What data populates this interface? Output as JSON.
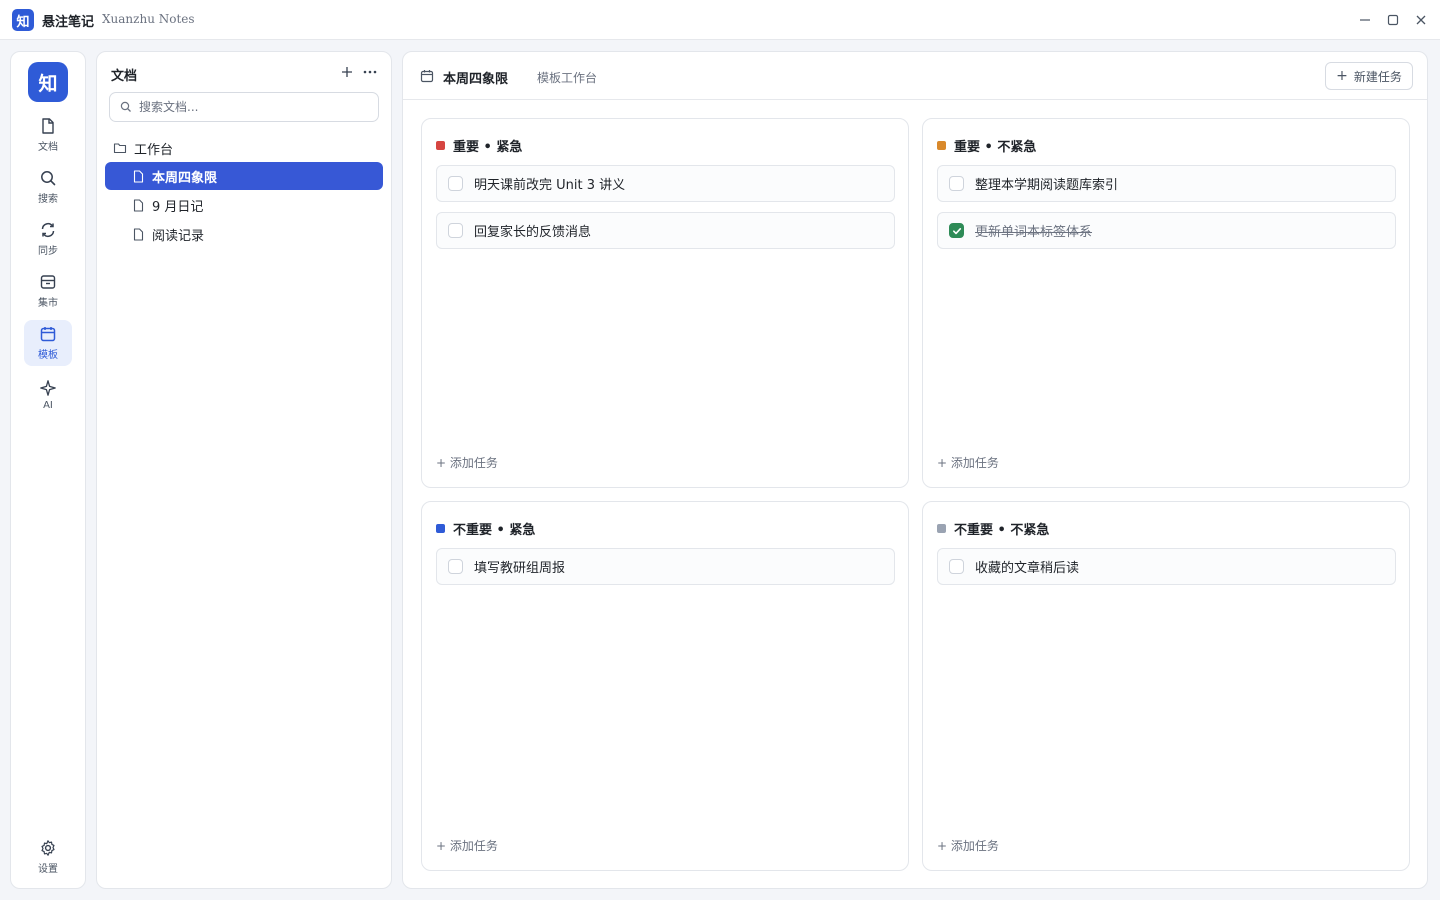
{
  "app": {
    "logo_char": "知",
    "name": "悬注笔记",
    "subtitle": "Xuanzhu Notes"
  },
  "window_controls": [
    "minimize-icon",
    "maximize-icon",
    "close-icon"
  ],
  "rail": {
    "logo_char": "知",
    "items": [
      {
        "label": "文档",
        "icon": "document-icon"
      },
      {
        "label": "搜索",
        "icon": "search-icon"
      },
      {
        "label": "同步",
        "icon": "sync-icon"
      },
      {
        "label": "集市",
        "icon": "marketplace-icon"
      },
      {
        "label": "模板",
        "icon": "calendar-icon",
        "active": true
      },
      {
        "label": "AI",
        "icon": "sparkle-icon"
      }
    ],
    "settings_label": "设置"
  },
  "docs": {
    "title": "文档",
    "search_placeholder": "搜索文档...",
    "folder": "工作台",
    "items": [
      {
        "label": "本周四象限",
        "active": true
      },
      {
        "label": "9 月日记"
      },
      {
        "label": "阅读记录"
      }
    ]
  },
  "main": {
    "title": "本周四象限",
    "breadcrumb": "模板工作台",
    "new_task_label": "新建任务",
    "add_task_label": "+ 添加任务",
    "quadrants": [
      {
        "title": "重要 • 紧急",
        "color": "#d64541",
        "tasks": [
          {
            "text": "明天课前改完 Unit 3 讲义",
            "done": false
          },
          {
            "text": "回复家长的反馈消息",
            "done": false
          }
        ]
      },
      {
        "title": "重要 • 不紧急",
        "color": "#d9892b",
        "tasks": [
          {
            "text": "整理本学期阅读题库索引",
            "done": false
          },
          {
            "text": "更新单词本标签体系",
            "done": true
          }
        ]
      },
      {
        "title": "不重要 • 紧急",
        "color": "#2f5bd7",
        "tasks": [
          {
            "text": "填写教研组周报",
            "done": false
          }
        ]
      },
      {
        "title": "不重要 • 不紧急",
        "color": "#9aa3b2",
        "tasks": [
          {
            "text": "收藏的文章稍后读",
            "done": false
          }
        ]
      }
    ]
  }
}
